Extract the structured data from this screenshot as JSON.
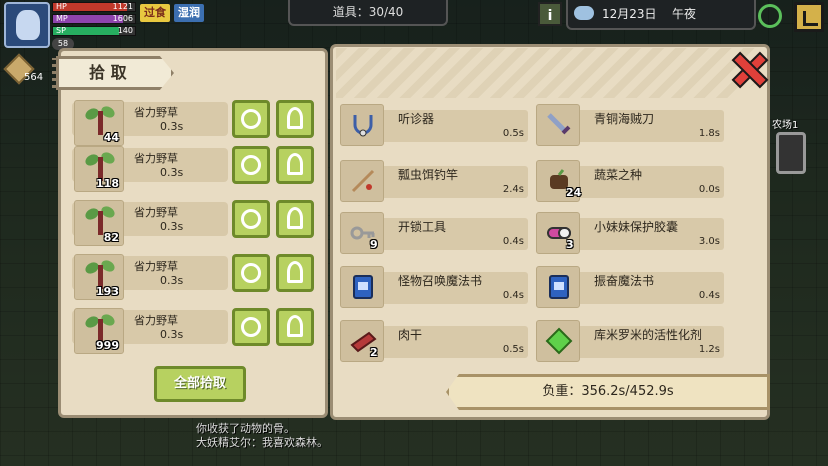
{
  "hud": {
    "hp_label": "HP",
    "hp_value": "1121",
    "mp_label": "MP",
    "mp_value": "1606",
    "sp_label": "SP",
    "sp_value": "140",
    "level": "58",
    "status_tags": [
      "过食",
      "湿润"
    ],
    "coins": "564",
    "items_counter": "道具：30/40",
    "info_symbol": "i",
    "date": "12月23日",
    "time_of_day": "午夜"
  },
  "pickup_panel": {
    "title": "拾 取",
    "rows": [
      {
        "name": "省力野草",
        "time": "0.3s",
        "qty": "44"
      },
      {
        "name": "省力野草",
        "time": "0.3s",
        "qty": "118"
      },
      {
        "name": "省力野草",
        "time": "0.3s",
        "qty": "82"
      },
      {
        "name": "省力野草",
        "time": "0.3s",
        "qty": "193"
      },
      {
        "name": "省力野草",
        "time": "0.3s",
        "qty": "999"
      }
    ],
    "pick_all_label": "全部拾取"
  },
  "inventory": {
    "items": [
      {
        "name": "听诊器",
        "time": "0.5s",
        "qty": "",
        "icon": "stethoscope-icon"
      },
      {
        "name": "青铜海贼刀",
        "time": "1.8s",
        "qty": "",
        "icon": "sword-icon"
      },
      {
        "name": "瓢虫饵钓竿",
        "time": "2.4s",
        "qty": "",
        "icon": "fishing-rod-icon"
      },
      {
        "name": "蔬菜之种",
        "time": "0.0s",
        "qty": "24",
        "icon": "seed-bag-icon"
      },
      {
        "name": "开锁工具",
        "time": "0.4s",
        "qty": "9",
        "icon": "key-icon"
      },
      {
        "name": "小妹妹保护胶囊",
        "time": "3.0s",
        "qty": "3",
        "icon": "capsule-icon"
      },
      {
        "name": "怪物召唤魔法书",
        "time": "0.4s",
        "qty": "",
        "icon": "spellbook-icon"
      },
      {
        "name": "振奋魔法书",
        "time": "0.4s",
        "qty": "",
        "icon": "spellbook-icon"
      },
      {
        "name": "肉干",
        "time": "0.5s",
        "qty": "2",
        "icon": "jerky-icon"
      },
      {
        "name": "库米罗米的活性化剂",
        "time": "1.2s",
        "qty": "",
        "icon": "gem-icon"
      }
    ],
    "weight_text": "负重：356.2s/452.9s"
  },
  "world": {
    "side_label": "农场1",
    "chat_lines": [
      "你收获了动物的骨。",
      "大妖精艾尔：我喜欢森林。"
    ]
  },
  "colors": {
    "panel_bg": "#e8dcc3",
    "button_green": "#b7d160",
    "close_red": "#e0403a"
  }
}
